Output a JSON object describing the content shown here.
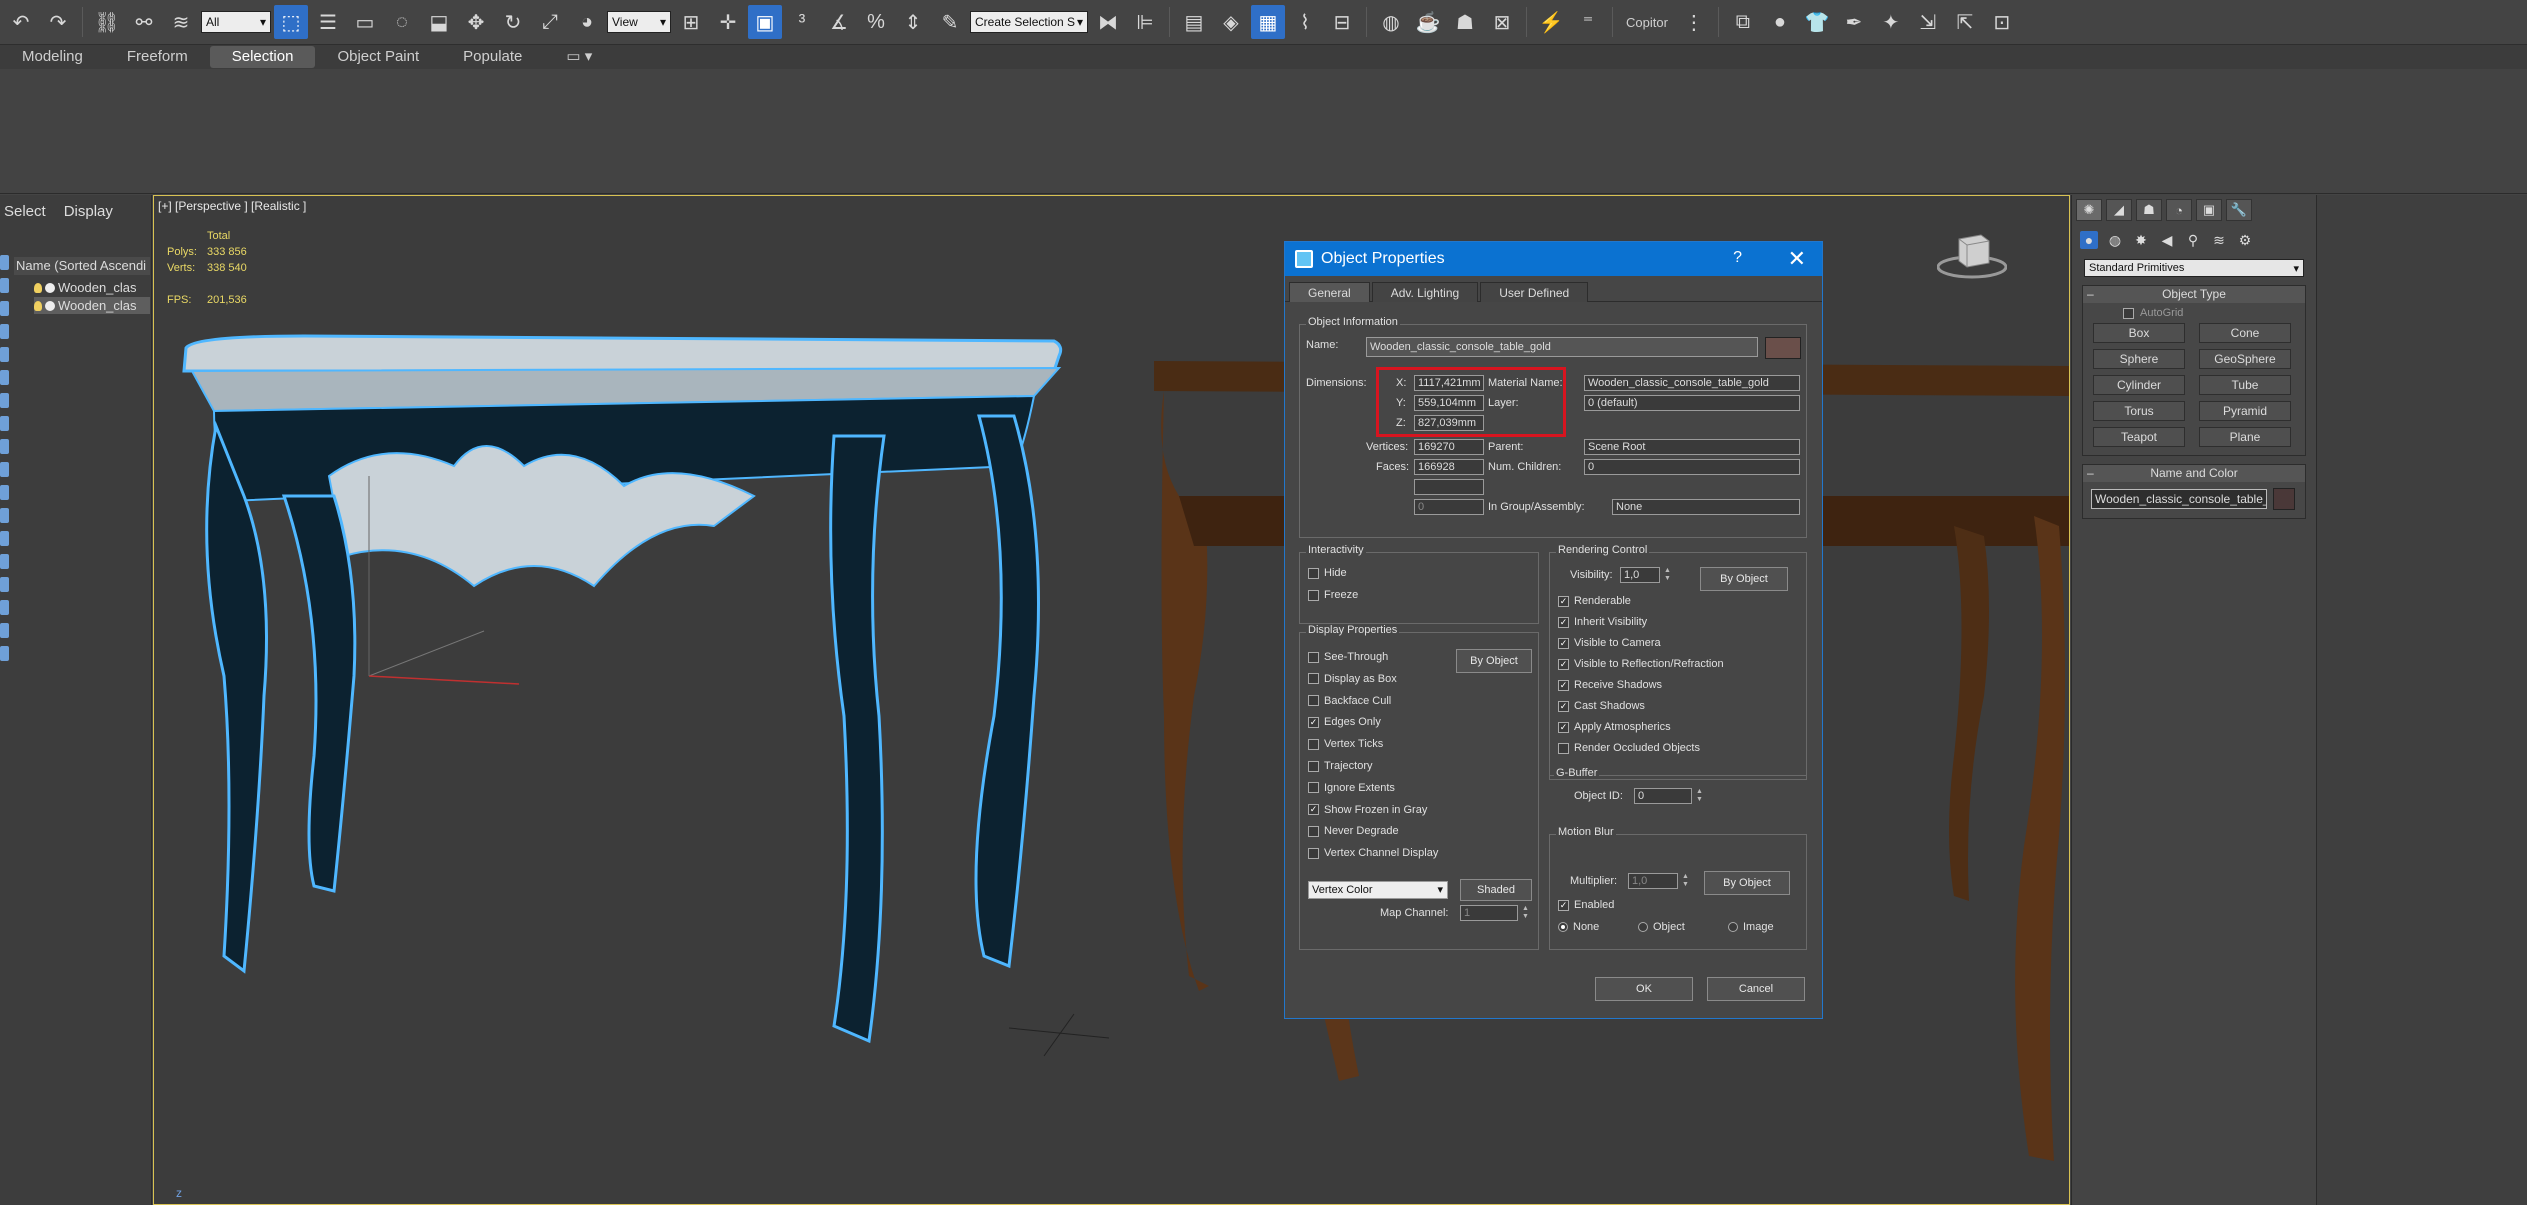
{
  "toolbar": {
    "filter_select": "All",
    "view_select": "View",
    "selection_set": "Create Selection S",
    "copitor_label": "Copitor"
  },
  "ribbon": {
    "tabs": [
      "Modeling",
      "Freeform",
      "Selection",
      "Object Paint",
      "Populate"
    ],
    "active_tab": "Selection"
  },
  "scene_explorer": {
    "tabs": [
      "Select",
      "Display"
    ],
    "header": "Name (Sorted Ascendi",
    "items": [
      "Wooden_clas",
      "Wooden_clas"
    ]
  },
  "viewport": {
    "label": "[+] [Perspective ] [Realistic ]",
    "stats": {
      "total_label": "Total",
      "polys_label": "Polys:",
      "polys": "333 856",
      "verts_label": "Verts:",
      "verts": "338 540",
      "fps_label": "FPS:",
      "fps": "201,536"
    },
    "axis_label": "z"
  },
  "command_panel": {
    "dropdown": "Standard Primitives",
    "object_type_title": "Object Type",
    "autogrid_label": "AutoGrid",
    "primitives": [
      "Box",
      "Cone",
      "Sphere",
      "GeoSphere",
      "Cylinder",
      "Tube",
      "Torus",
      "Pyramid",
      "Teapot",
      "Plane"
    ],
    "name_color_title": "Name and Color",
    "object_name": "Wooden_classic_console_table_gold"
  },
  "dialog": {
    "title": "Object Properties",
    "help": "?",
    "tabs": [
      "General",
      "Adv. Lighting",
      "User Defined"
    ],
    "object_info": {
      "title": "Object Information",
      "name_label": "Name:",
      "name_value": "Wooden_classic_console_table_gold",
      "dimensions_label": "Dimensions:",
      "x_label": "X:",
      "x_value": "1117,421mm",
      "y_label": "Y:",
      "y_value": "559,104mm",
      "z_label": "Z:",
      "z_value": "827,039mm",
      "material_label": "Material Name:",
      "material_value": "Wooden_classic_console_table_gold",
      "layer_label": "Layer:",
      "layer_value": "0 (default)",
      "vertices_label": "Vertices:",
      "vertices_value": "169270",
      "faces_label": "Faces:",
      "faces_value": "166928",
      "parent_label": "Parent:",
      "parent_value": "Scene Root",
      "children_label": "Num. Children:",
      "children_value": "0",
      "group_label": "In Group/Assembly:",
      "group_value": "None",
      "extra_value": "0"
    },
    "interactivity": {
      "title": "Interactivity",
      "hide": "Hide",
      "freeze": "Freeze"
    },
    "display_properties": {
      "title": "Display Properties",
      "by_object": "By Object",
      "options": [
        {
          "label": "See-Through",
          "checked": false
        },
        {
          "label": "Display as Box",
          "checked": false
        },
        {
          "label": "Backface Cull",
          "checked": false
        },
        {
          "label": "Edges Only",
          "checked": true
        },
        {
          "label": "Vertex Ticks",
          "checked": false
        },
        {
          "label": "Trajectory",
          "checked": false
        },
        {
          "label": "Ignore Extents",
          "checked": false
        },
        {
          "label": "Show Frozen in Gray",
          "checked": true
        },
        {
          "label": "Never Degrade",
          "checked": false
        },
        {
          "label": "Vertex Channel Display",
          "checked": false
        }
      ],
      "vertex_select": "Vertex Color",
      "shaded_button": "Shaded",
      "map_channel_label": "Map Channel:",
      "map_channel_value": "1"
    },
    "rendering_control": {
      "title": "Rendering Control",
      "visibility_label": "Visibility:",
      "visibility_value": "1,0",
      "by_object": "By Object",
      "options": [
        {
          "label": "Renderable",
          "checked": true
        },
        {
          "label": "Inherit Visibility",
          "checked": true
        },
        {
          "label": "Visible to Camera",
          "checked": true
        },
        {
          "label": "Visible to Reflection/Refraction",
          "checked": true
        },
        {
          "label": "Receive Shadows",
          "checked": true
        },
        {
          "label": "Cast Shadows",
          "checked": true
        },
        {
          "label": "Apply Atmospherics",
          "checked": true
        },
        {
          "label": "Render Occluded Objects",
          "checked": false
        }
      ]
    },
    "gbuffer": {
      "title": "G-Buffer",
      "object_id_label": "Object ID:",
      "object_id_value": "0"
    },
    "motion_blur": {
      "title": "Motion Blur",
      "multiplier_label": "Multiplier:",
      "multiplier_value": "1,0",
      "by_object": "By Object",
      "enabled_label": "Enabled",
      "radios": [
        "None",
        "Object",
        "Image"
      ],
      "selected_radio": "None"
    },
    "ok": "OK",
    "cancel": "Cancel"
  },
  "colors": {
    "accent": "#0b72d1",
    "highlight": "#d8141f",
    "stats": "#e9d865"
  }
}
